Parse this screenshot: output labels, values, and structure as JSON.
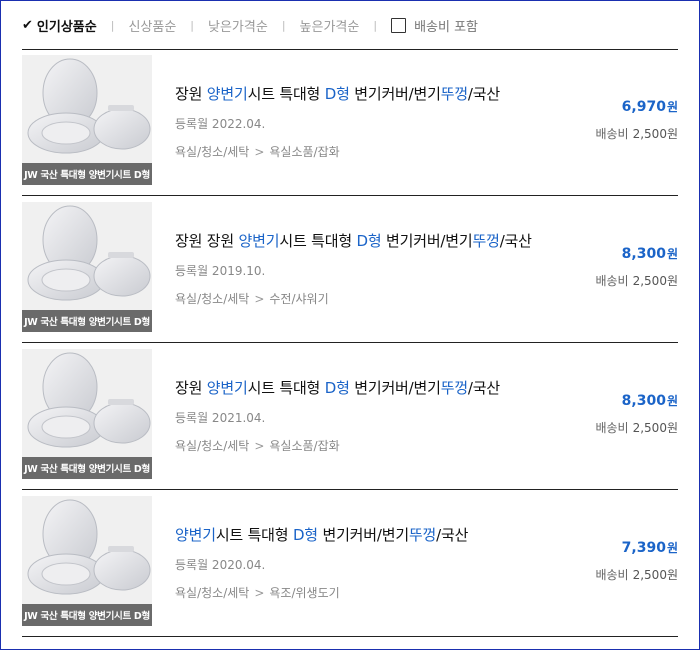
{
  "sort_bar": {
    "active_check": "✔",
    "options": [
      "인기상품순",
      "신상품순",
      "낮은가격순",
      "높은가격순"
    ],
    "separator": "|",
    "shipping_toggle_label": "배송비 포함"
  },
  "products": [
    {
      "title_parts": [
        {
          "text": "장원 ",
          "hl": false
        },
        {
          "text": "양변기",
          "hl": true
        },
        {
          "text": "시트 특대형 ",
          "hl": false
        },
        {
          "text": "D형",
          "hl": true
        },
        {
          "text": " 변기커버/변기",
          "hl": false
        },
        {
          "text": "뚜껑",
          "hl": true
        },
        {
          "text": "/국산",
          "hl": false
        }
      ],
      "reg_date": "등록월 2022.04.",
      "category": [
        "욕실/청소/세탁",
        "욕실소품/잡화"
      ],
      "price": "6,970",
      "price_unit": "원",
      "shipping_label": "배송비",
      "shipping_amount": "2,500원",
      "thumb_caption": "JW 국산 특대형 양변기시트 D형"
    },
    {
      "title_parts": [
        {
          "text": "장원 장원 ",
          "hl": false
        },
        {
          "text": "양변기",
          "hl": true
        },
        {
          "text": "시트 특대형 ",
          "hl": false
        },
        {
          "text": "D형",
          "hl": true
        },
        {
          "text": " 변기커버/변기",
          "hl": false
        },
        {
          "text": "뚜껑",
          "hl": true
        },
        {
          "text": "/국산",
          "hl": false
        }
      ],
      "reg_date": "등록월 2019.10.",
      "category": [
        "욕실/청소/세탁",
        "수전/샤워기"
      ],
      "price": "8,300",
      "price_unit": "원",
      "shipping_label": "배송비",
      "shipping_amount": "2,500원",
      "thumb_caption": "JW 국산 특대형 양변기시트 D형"
    },
    {
      "title_parts": [
        {
          "text": "장원 ",
          "hl": false
        },
        {
          "text": "양변기",
          "hl": true
        },
        {
          "text": "시트 특대형 ",
          "hl": false
        },
        {
          "text": "D형",
          "hl": true
        },
        {
          "text": " 변기커버/변기",
          "hl": false
        },
        {
          "text": "뚜껑",
          "hl": true
        },
        {
          "text": "/국산",
          "hl": false
        }
      ],
      "reg_date": "등록월 2021.04.",
      "category": [
        "욕실/청소/세탁",
        "욕실소품/잡화"
      ],
      "price": "8,300",
      "price_unit": "원",
      "shipping_label": "배송비",
      "shipping_amount": "2,500원",
      "thumb_caption": "JW 국산 특대형 양변기시트 D형"
    },
    {
      "title_parts": [
        {
          "text": "양변기",
          "hl": true
        },
        {
          "text": "시트 특대형 ",
          "hl": false
        },
        {
          "text": "D형",
          "hl": true
        },
        {
          "text": " 변기커버/변기",
          "hl": false
        },
        {
          "text": "뚜껑",
          "hl": true
        },
        {
          "text": "/국산",
          "hl": false
        }
      ],
      "reg_date": "등록월 2020.04.",
      "category": [
        "욕실/청소/세탁",
        "욕조/위생도기"
      ],
      "price": "7,390",
      "price_unit": "원",
      "shipping_label": "배송비",
      "shipping_amount": "2,500원",
      "thumb_caption": "JW 국산 특대형 양변기시트 D형"
    }
  ],
  "colors": {
    "highlight": "#1b64c8",
    "frame_border": "#1a2fb0",
    "caption_bg": "#6a6a6a"
  }
}
